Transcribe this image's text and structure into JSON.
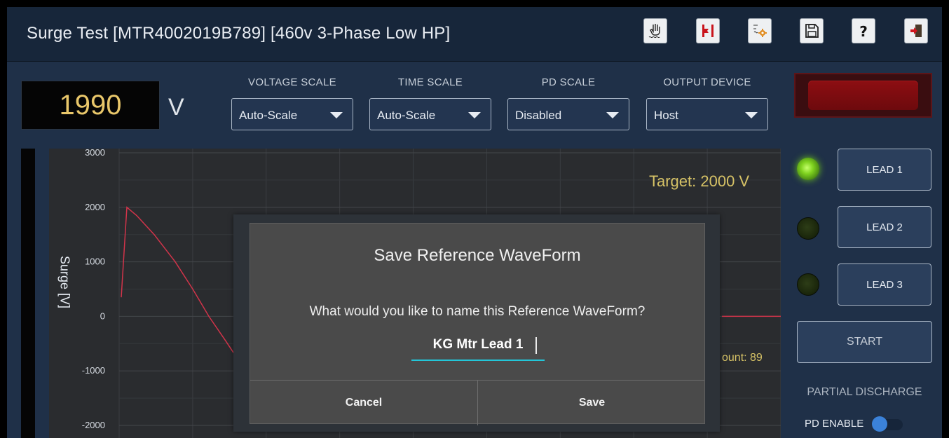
{
  "title_bar": {
    "title": "Surge Test  [MTR4002019B789] [460v 3-Phase Low HP]",
    "buttons": [
      {
        "name": "manual-test-icon"
      },
      {
        "name": "flag-marker-icon"
      },
      {
        "name": "waveform-settings-icon"
      },
      {
        "name": "save-disk-icon"
      },
      {
        "name": "help-icon"
      },
      {
        "name": "exit-icon"
      }
    ]
  },
  "readout": {
    "value": "1990",
    "unit": "V"
  },
  "controls": {
    "voltage_scale": {
      "label": "VOLTAGE SCALE",
      "value": "Auto-Scale"
    },
    "time_scale": {
      "label": "TIME SCALE",
      "value": "Auto-Scale"
    },
    "pd_scale": {
      "label": "PD SCALE",
      "value": "Disabled"
    },
    "output_device": {
      "label": "OUTPUT DEVICE",
      "value": "Host"
    }
  },
  "chart": {
    "target_text": "Target: 2000 V",
    "count_text": "ount: 89",
    "ylabel": "Surge [V]",
    "line_color": "#d1344a"
  },
  "chart_data": {
    "type": "line",
    "ylabel": "Surge [V]",
    "ylim": [
      -2000,
      3000
    ],
    "yticks": [
      3000,
      2000,
      1000,
      0,
      -1000,
      -2000
    ],
    "series": [
      {
        "values": [
          350,
          2000,
          1850,
          1500,
          1000,
          500,
          0,
          -450,
          -800,
          -880
        ]
      },
      {
        "values": [
          0,
          0
        ]
      }
    ],
    "grid": true
  },
  "leads": [
    {
      "label": "LEAD 1",
      "led": "on"
    },
    {
      "label": "LEAD 2",
      "led": "off"
    },
    {
      "label": "LEAD 3",
      "led": "off"
    }
  ],
  "start_label": "START",
  "partial_discharge": {
    "title": "PARTIAL DISCHARGE",
    "enable_label": "PD ENABLE"
  },
  "modal": {
    "title": "Save Reference WaveForm",
    "message": "What would you like to name this Reference WaveForm?",
    "input_value": "KG Mtr Lead 1",
    "cancel_label": "Cancel",
    "save_label": "Save"
  }
}
